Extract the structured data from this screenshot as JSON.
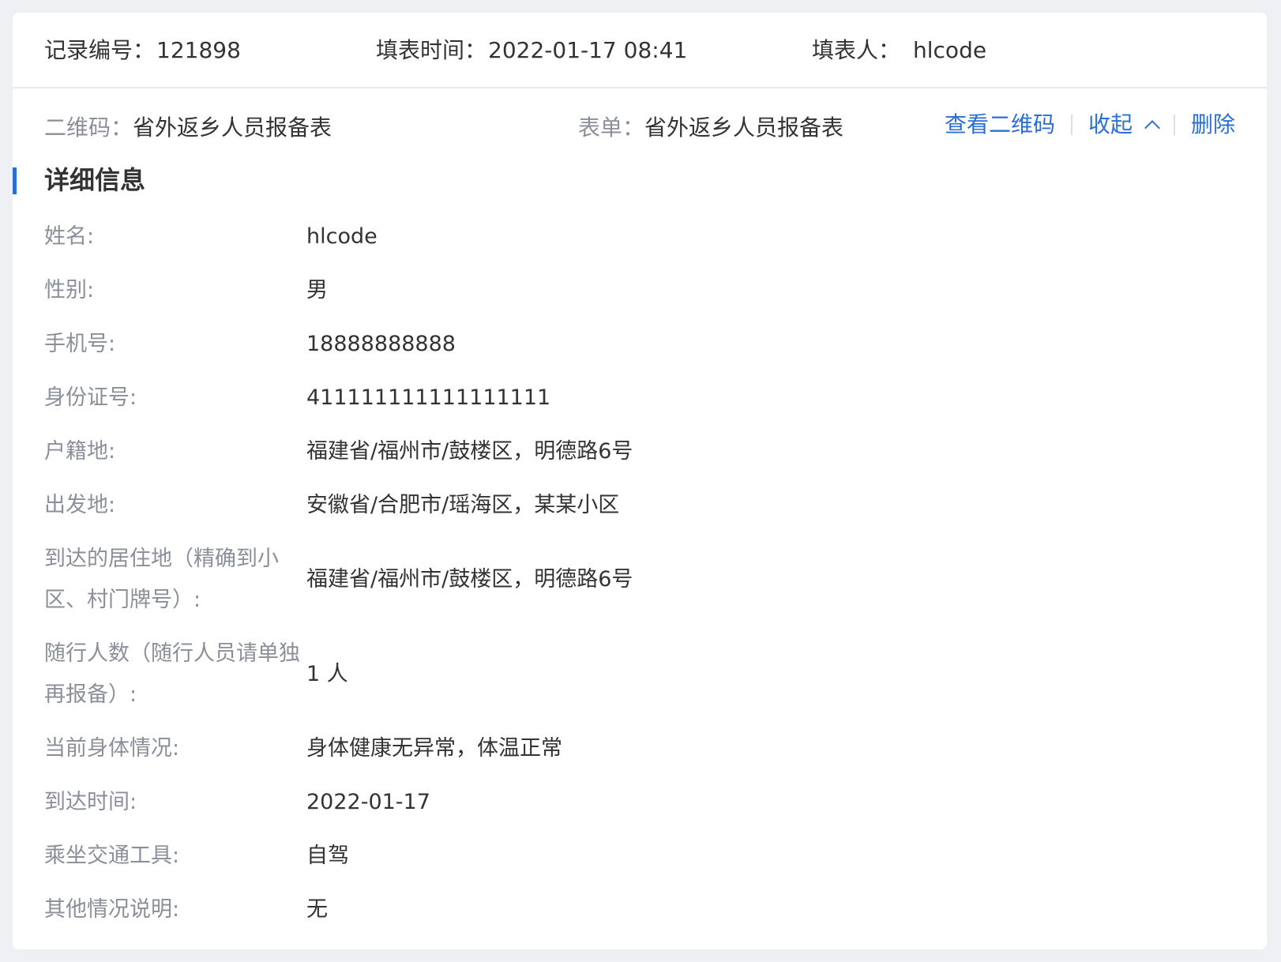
{
  "header": {
    "record_no_label": "记录编号：",
    "record_no_value": "121898",
    "fill_time_label": "填表时间：",
    "fill_time_value": "2022-01-17 08:41",
    "filler_label": "填表人：",
    "filler_value": "hlcode"
  },
  "meta": {
    "qrcode_label": "二维码：",
    "qrcode_value": "省外返乡人员报备表",
    "form_label": "表单：",
    "form_value": "省外返乡人员报备表"
  },
  "actions": {
    "view_qrcode": "查看二维码",
    "collapse": "收起",
    "delete": "删除"
  },
  "section": {
    "title": "详细信息"
  },
  "details": [
    {
      "label": "姓名:",
      "value": "hlcode"
    },
    {
      "label": "性别:",
      "value": "男"
    },
    {
      "label": "手机号:",
      "value": "18888888888"
    },
    {
      "label": "身份证号:",
      "value": "411111111111111111"
    },
    {
      "label": "户籍地:",
      "value": "福建省/福州市/鼓楼区，明德路6号"
    },
    {
      "label": "出发地:",
      "value": "安徽省/合肥市/瑶海区，某某小区"
    },
    {
      "label": "到达的居住地（精确到小区、村门牌号）:",
      "value": "福建省/福州市/鼓楼区，明德路6号"
    },
    {
      "label": "随行人数（随行人员请单独再报备）:",
      "value": "1 人"
    },
    {
      "label": "当前身体情况:",
      "value": "身体健康无异常，体温正常"
    },
    {
      "label": "到达时间:",
      "value": "2022-01-17"
    },
    {
      "label": "乘坐交通工具:",
      "value": "自驾"
    },
    {
      "label": "其他情况说明:",
      "value": "无"
    }
  ],
  "colors": {
    "accent": "#2b6fd6",
    "label": "#8a8f99",
    "text": "#333333",
    "background": "#eef0f4"
  }
}
